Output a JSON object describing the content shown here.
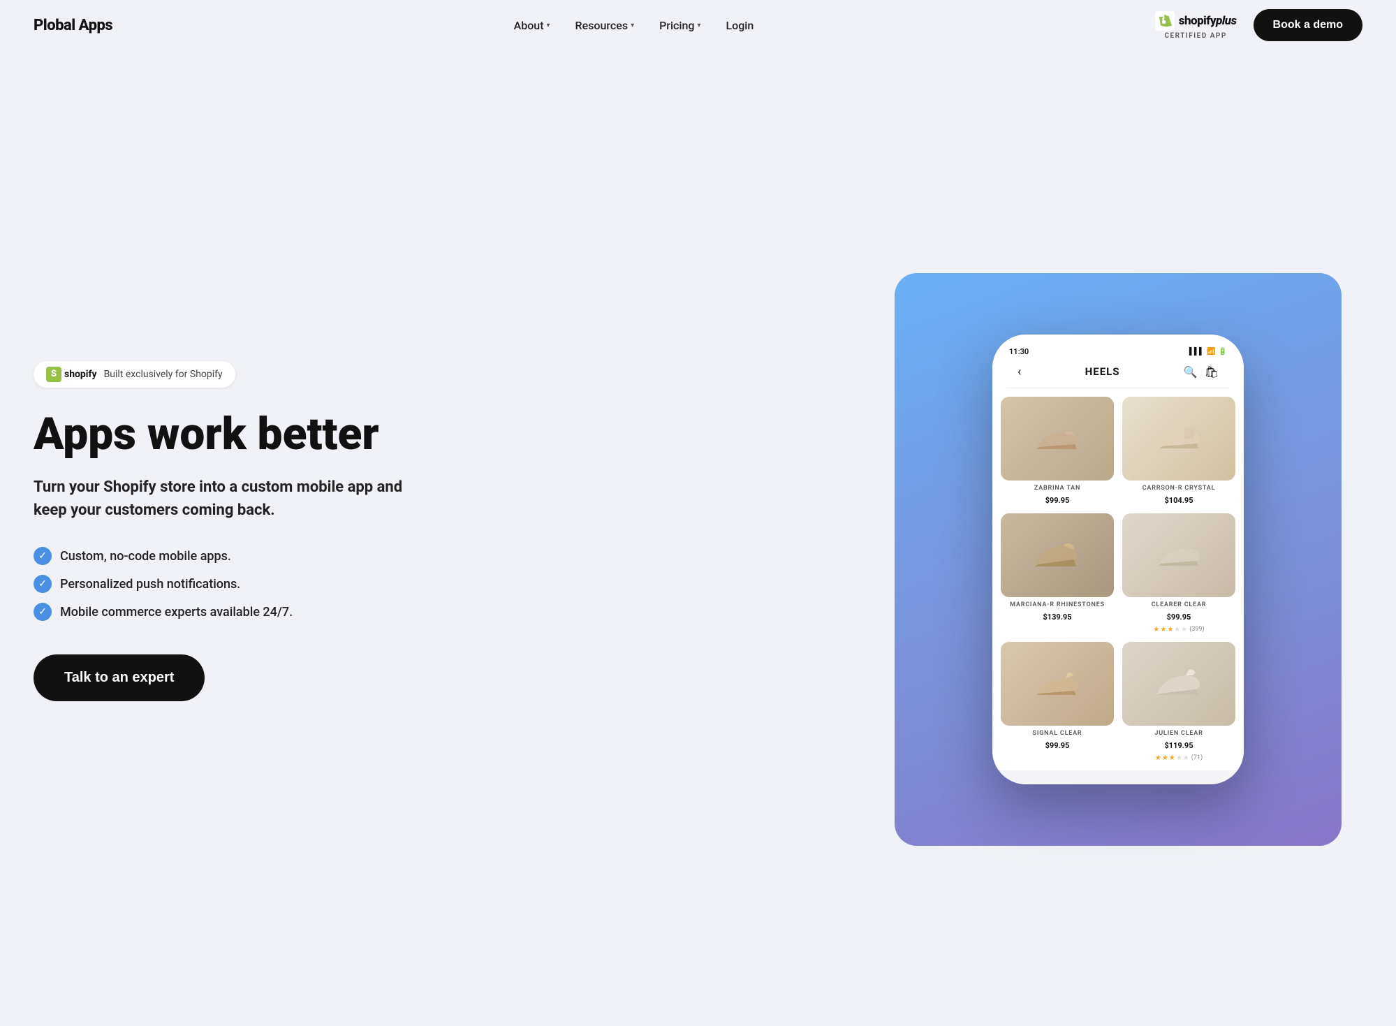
{
  "brand": {
    "name": "Plobal Apps"
  },
  "nav": {
    "links": [
      {
        "label": "About",
        "has_dropdown": true
      },
      {
        "label": "Resources",
        "has_dropdown": true
      },
      {
        "label": "Pricing",
        "has_dropdown": true
      },
      {
        "label": "Login",
        "has_dropdown": false
      }
    ],
    "shopify_certified": {
      "badge_text": "shopifyplus",
      "certified_label": "CERTIFIED APP"
    },
    "cta": {
      "label": "Book a demo"
    }
  },
  "hero": {
    "badge": {
      "logo_text": "shopify",
      "description": "Built exclusively for Shopify"
    },
    "title": "Apps work better",
    "subtitle": "Turn your Shopify store into a custom mobile app and keep your customers coming back.",
    "features": [
      "Custom, no-code mobile apps.",
      "Personalized push notifications.",
      "Mobile commerce experts available 24/7."
    ],
    "cta_label": "Talk to an expert"
  },
  "phone": {
    "status_time": "11:30",
    "page_title": "HEELS",
    "products": [
      {
        "name": "ZABRINA TAN",
        "price": "$99.95",
        "stars": 0,
        "reviews": "",
        "shoe_class": "shoe-1"
      },
      {
        "name": "CARRSON-R CRYSTAL",
        "price": "$104.95",
        "stars": 0,
        "reviews": "",
        "shoe_class": "shoe-2"
      },
      {
        "name": "MARCIANA-R RHINESTONES",
        "price": "$139.95",
        "stars": 0,
        "reviews": "",
        "shoe_class": "shoe-3"
      },
      {
        "name": "CLEARER CLEAR",
        "price": "$99.95",
        "stars": 3.5,
        "reviews": "(399)",
        "shoe_class": "shoe-4"
      },
      {
        "name": "SIGNAL CLEAR",
        "price": "$99.95",
        "stars": 0,
        "reviews": "",
        "shoe_class": "shoe-5"
      },
      {
        "name": "JULIEN CLEAR",
        "price": "$119.95",
        "stars": 3.5,
        "reviews": "(71)",
        "shoe_class": "shoe-6"
      }
    ]
  },
  "colors": {
    "accent": "#111111",
    "blue": "#4a90e2",
    "phone_bg_start": "#6ab0f5",
    "phone_bg_end": "#8875c9"
  }
}
